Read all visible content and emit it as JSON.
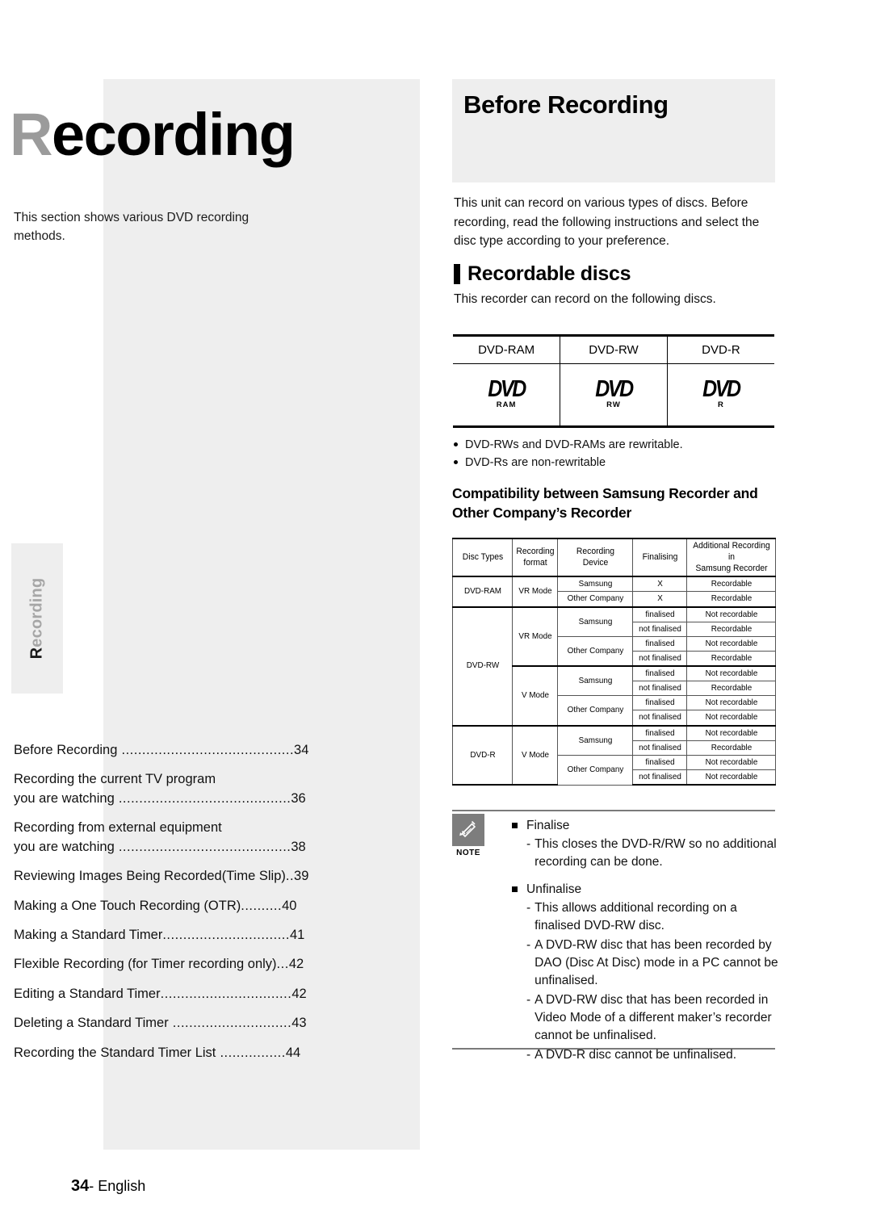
{
  "document": {
    "footer": {
      "page_number": "34",
      "language": "- English"
    }
  },
  "side_tab": {
    "first_letter": "R",
    "rest": "ecording"
  },
  "left_column": {
    "title_first_letter": "R",
    "title_rest": "ecording",
    "intro": "This section shows various DVD recording methods.",
    "toc": [
      {
        "line1": "Before Recording",
        "leader": " ..........................................",
        "page": "34",
        "line2": ""
      },
      {
        "line1": "Recording the current TV program",
        "line2": "you are watching",
        "leader": " ..........................................",
        "page": "36"
      },
      {
        "line1": "Recording from external equipment",
        "line2": "you are watching",
        "leader": " ..........................................",
        "page": "38"
      },
      {
        "line1": "Reviewing Images Being Recorded(Time Slip)",
        "leader": "..",
        "page": "39",
        "line2": ""
      },
      {
        "line1": "Making a One Touch Recording (OTR)",
        "leader": "..........",
        "page": "40",
        "line2": ""
      },
      {
        "line1": "Making a Standard Timer",
        "leader": "...............................",
        "page": "41",
        "line2": ""
      },
      {
        "line1": "Flexible Recording (for Timer recording only)",
        "leader": "...",
        "page": "42",
        "line2": ""
      },
      {
        "line1": "Editing a Standard Timer",
        "leader": "................................",
        "page": "42",
        "line2": ""
      },
      {
        "line1": "Deleting a Standard Timer",
        "leader": " .............................",
        "page": "43",
        "line2": ""
      },
      {
        "line1": "Recording the Standard Timer List",
        "leader": " ................",
        "page": "44",
        "line2": ""
      }
    ]
  },
  "right_column": {
    "header_title": "Before Recording",
    "intro": "This unit can record on various types of discs. Before recording, read the following instructions and select the disc type according to your preference.",
    "section_heading": "Recordable discs",
    "sub_intro": "This recorder can record on the following discs.",
    "disc_table": {
      "headers": [
        "DVD-RAM",
        "DVD-RW",
        "DVD-R"
      ],
      "logos": [
        {
          "word": "DVD",
          "sub": "RAM"
        },
        {
          "word": "DVD",
          "sub": "RW"
        },
        {
          "word": "DVD",
          "sub": "R"
        }
      ]
    },
    "bullets": [
      "DVD-RWs and DVD-RAMs are rewritable.",
      "DVD-Rs are non-rewritable"
    ],
    "compat_heading_line1": "Compatibility between Samsung Recorder and",
    "compat_heading_line2": "Other Company’s Recorder",
    "compat_table": {
      "headers": [
        "Disc Types",
        "Recording format",
        "Recording Device",
        "Finalising",
        "Additional Recording in Samsung Recorder"
      ],
      "header_cells": [
        {
          "l1": "Disc Types",
          "l2": ""
        },
        {
          "l1": "Recording",
          "l2": "format"
        },
        {
          "l1": "Recording",
          "l2": "Device"
        },
        {
          "l1": "Finalising",
          "l2": ""
        },
        {
          "l1": "Additional Recording in",
          "l2": "Samsung Recorder"
        }
      ],
      "rows": [
        {
          "disc": "DVD-RAM",
          "format": "VR Mode",
          "device": "Samsung",
          "finalising": "X",
          "additional": "Recordable"
        },
        {
          "disc": "",
          "format": "",
          "device": "Other Company",
          "finalising": "X",
          "additional": "Recordable"
        },
        {
          "disc": "DVD-RW",
          "format": "VR Mode",
          "device": "Samsung",
          "finalising": "finalised",
          "additional": "Not recordable"
        },
        {
          "disc": "",
          "format": "",
          "device": "",
          "finalising": "not finalised",
          "additional": "Recordable"
        },
        {
          "disc": "",
          "format": "",
          "device": "Other Company",
          "finalising": "finalised",
          "additional": "Not recordable"
        },
        {
          "disc": "",
          "format": "",
          "device": "",
          "finalising": "not finalised",
          "additional": "Recordable"
        },
        {
          "disc": "",
          "format": "V Mode",
          "device": "Samsung",
          "finalising": "finalised",
          "additional": "Not recordable"
        },
        {
          "disc": "",
          "format": "",
          "device": "",
          "finalising": "not finalised",
          "additional": "Recordable"
        },
        {
          "disc": "",
          "format": "",
          "device": "Other Company",
          "finalising": "finalised",
          "additional": "Not recordable"
        },
        {
          "disc": "",
          "format": "",
          "device": "",
          "finalising": "not finalised",
          "additional": "Not recordable"
        },
        {
          "disc": "DVD-R",
          "format": "V Mode",
          "device": "Samsung",
          "finalising": "finalised",
          "additional": "Not recordable"
        },
        {
          "disc": "",
          "format": "",
          "device": "",
          "finalising": "not finalised",
          "additional": "Recordable"
        },
        {
          "disc": "",
          "format": "",
          "device": "Other Company",
          "finalising": "finalised",
          "additional": "Not recordable"
        },
        {
          "disc": "",
          "format": "",
          "device": "",
          "finalising": "not finalised",
          "additional": "Not recordable"
        }
      ],
      "cells": {
        "dvdram": "DVD-RAM",
        "dvdrw": "DVD-RW",
        "dvdr": "DVD-R",
        "vr_mode": "VR Mode",
        "v_mode": "V Mode",
        "samsung": "Samsung",
        "other_company": "Other Company",
        "x": "X",
        "finalised": "finalised",
        "not_finalised": "not finalised",
        "recordable": "Recordable",
        "not_recordable": "Not recordable"
      }
    },
    "note": {
      "label": "NOTE",
      "items": [
        {
          "title": "Finalise",
          "subs": [
            "This closes the DVD-R/RW so no additional recording can be done."
          ]
        },
        {
          "title": "Unfinalise",
          "subs": [
            "This allows additional recording on a finalised DVD-RW disc.",
            "A DVD-RW disc that has been recorded by DAO (Disc At Disc) mode in a PC cannot be unfinalised.",
            "A DVD-RW disc that has been recorded in Video Mode of a different maker’s recorder cannot be unfinalised.",
            "A DVD-R disc cannot be unfinalised."
          ]
        }
      ]
    }
  },
  "colors": {
    "panel_gray": "#eeeeee",
    "note_icon_gray": "#7d7d7d",
    "title_cap_gray": "#9b9b9b"
  }
}
